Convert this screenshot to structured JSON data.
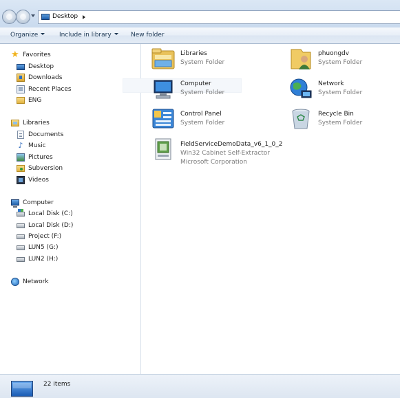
{
  "window": {
    "address": {
      "location": "Desktop"
    }
  },
  "toolbar": {
    "organize_label": "Organize",
    "include_label": "Include in library",
    "new_folder_label": "New folder"
  },
  "navigation": {
    "favorites": {
      "label": "Favorites",
      "items": [
        {
          "label": "Desktop",
          "icon": "desktop-icon"
        },
        {
          "label": "Downloads",
          "icon": "downloads-icon"
        },
        {
          "label": "Recent Places",
          "icon": "recent-places-icon"
        },
        {
          "label": "ENG",
          "icon": "folder-icon"
        }
      ]
    },
    "libraries": {
      "label": "Libraries",
      "items": [
        {
          "label": "Documents",
          "icon": "documents-icon"
        },
        {
          "label": "Music",
          "icon": "music-icon"
        },
        {
          "label": "Pictures",
          "icon": "pictures-icon"
        },
        {
          "label": "Subversion",
          "icon": "subversion-icon"
        },
        {
          "label": "Videos",
          "icon": "videos-icon"
        }
      ]
    },
    "computer": {
      "label": "Computer",
      "items": [
        {
          "label": "Local Disk (C:)",
          "icon": "system-disk-icon"
        },
        {
          "label": "Local Disk (D:)",
          "icon": "disk-icon"
        },
        {
          "label": "Project (F:)",
          "icon": "disk-icon"
        },
        {
          "label": "LUN5 (G:)",
          "icon": "disk-icon"
        },
        {
          "label": "LUN2 (H:)",
          "icon": "disk-icon"
        }
      ]
    },
    "network": {
      "label": "Network"
    }
  },
  "content": {
    "items": [
      {
        "name": "Libraries",
        "type": "System Folder",
        "icon": "libraries-icon"
      },
      {
        "name": "phuongdv",
        "type": "System Folder",
        "icon": "user-folder-icon"
      },
      {
        "name": "Computer",
        "type": "System Folder",
        "icon": "computer-icon"
      },
      {
        "name": "Network",
        "type": "System Folder",
        "icon": "network-icon"
      },
      {
        "name": "Control Panel",
        "type": "System Folder",
        "icon": "control-panel-icon"
      },
      {
        "name": "Recycle Bin",
        "type": "System Folder",
        "icon": "recycle-bin-icon"
      },
      {
        "name": "FieldServiceDemoData_v6_1_0_2",
        "type": "Win32 Cabinet Self-Extractor",
        "company": "Microsoft Corporation",
        "icon": "installer-icon"
      }
    ]
  },
  "status": {
    "count_text": "22 items"
  }
}
